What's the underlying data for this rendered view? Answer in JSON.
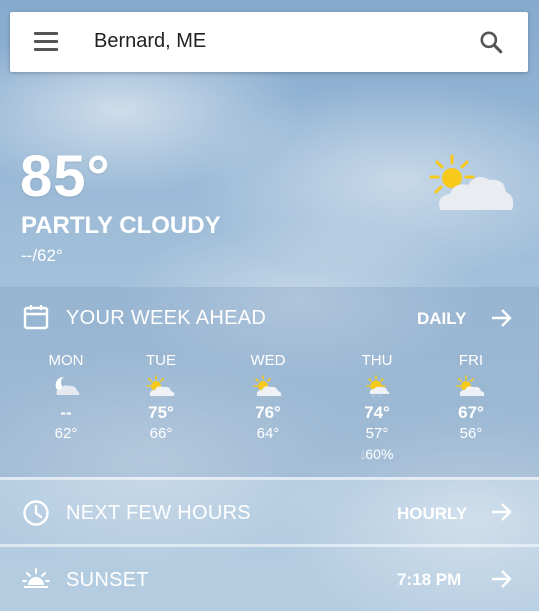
{
  "search": {
    "location": "Bernard, ME"
  },
  "current": {
    "temp": "85°",
    "condition": "PARTLY CLOUDY",
    "hilo": "--/62°",
    "icon": "partly-sunny-icon"
  },
  "week": {
    "title": "YOUR WEEK AHEAD",
    "link": "DAILY",
    "days": [
      {
        "name": "MON",
        "hi": "--",
        "lo": "62°",
        "icon": "moon-cloud-icon",
        "precip": ""
      },
      {
        "name": "TUE",
        "hi": "75°",
        "lo": "66°",
        "icon": "partly-sunny-icon",
        "precip": ""
      },
      {
        "name": "WED",
        "hi": "76°",
        "lo": "64°",
        "icon": "partly-sunny-icon",
        "precip": ""
      },
      {
        "name": "THU",
        "hi": "74°",
        "lo": "57°",
        "icon": "sun-rain-icon",
        "precip": "60%"
      },
      {
        "name": "FRI",
        "hi": "67°",
        "lo": "56°",
        "icon": "partly-sunny-icon",
        "precip": ""
      }
    ]
  },
  "hours": {
    "title": "NEXT FEW HOURS",
    "link": "HOURLY"
  },
  "sunset": {
    "title": "SUNSET",
    "time": "7:18 PM"
  },
  "colors": {
    "sun": "#f7c91a",
    "cloud": "#ffffff",
    "accent": "#ffffff"
  }
}
